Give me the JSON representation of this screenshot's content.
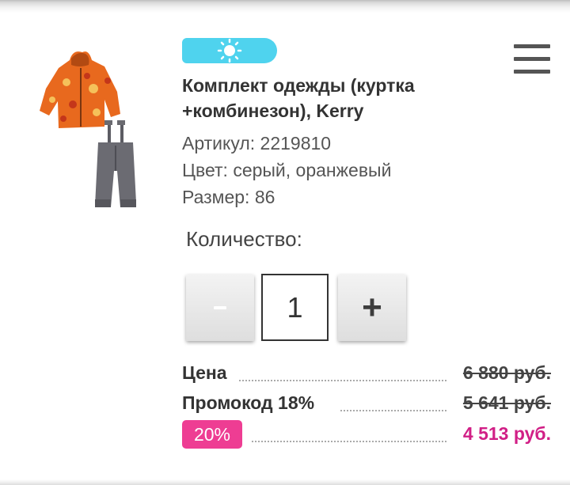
{
  "product": {
    "title": "Комплект одежды (куртка +комбинезон), Kerry",
    "image_icon": "jacket-and-overalls-image",
    "season_icon": "sun-icon",
    "article": "Артикул: 2219810",
    "color": "Цвет: серый, оранжевый",
    "size": "Размер: 86"
  },
  "menu": {
    "icon": "hamburger-icon"
  },
  "quantity": {
    "label": "Количество:",
    "minus_label": "-",
    "value": "1",
    "plus_label": "+"
  },
  "pricing": {
    "price_label": "Цена",
    "price_value": "6 880 руб.",
    "promo_label": "Промокод 18%",
    "promo_value": "5 641 руб.",
    "discount_badge": "20%",
    "final_value": "4 513 руб."
  },
  "colors": {
    "season_badge": "#4fd3ee",
    "discount_badge": "#ee3d93",
    "final_price": "#d11f86"
  }
}
